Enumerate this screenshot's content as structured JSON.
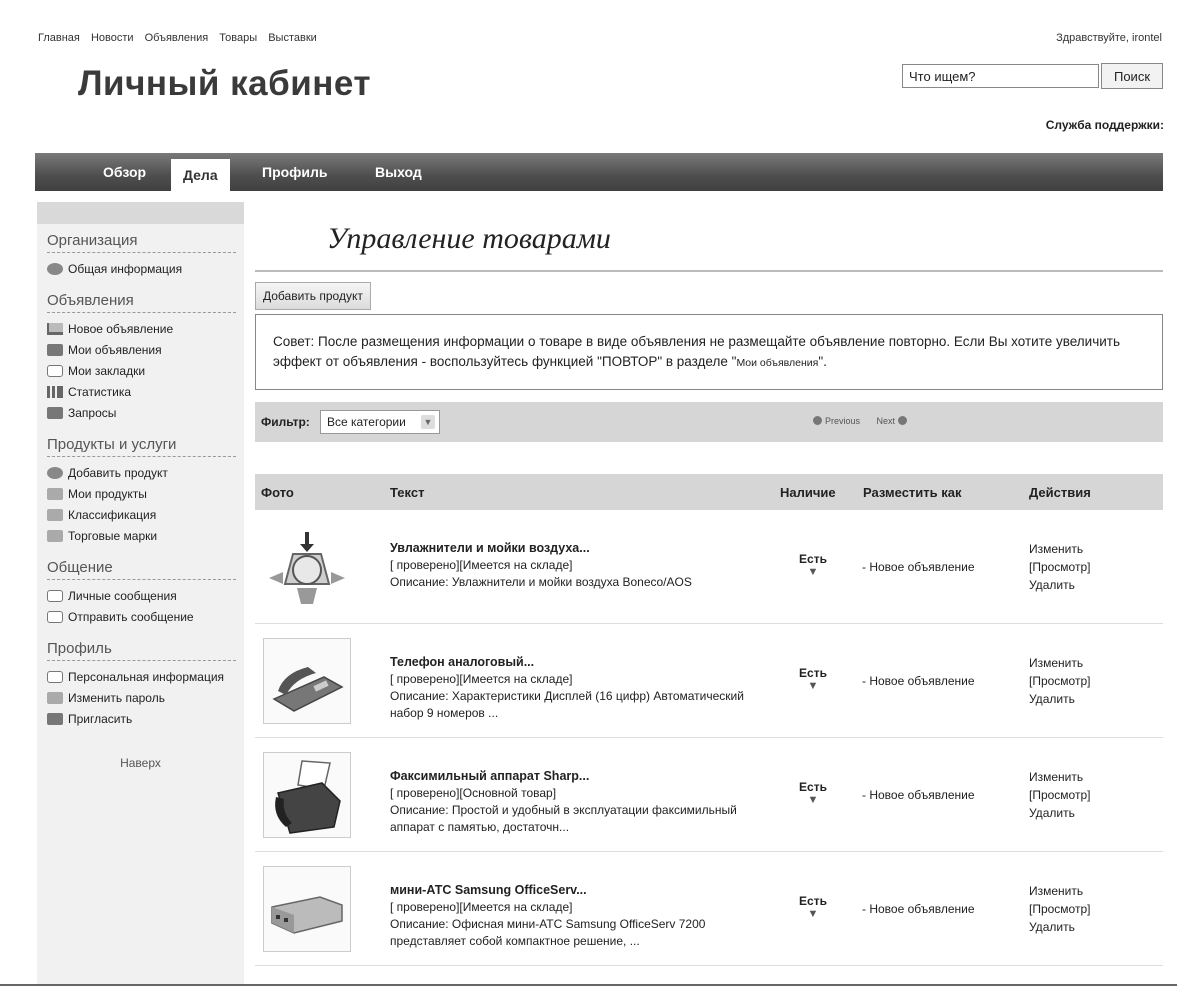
{
  "topnav": [
    "Главная",
    "Новости",
    "Объявления",
    "Товары",
    "Выставки"
  ],
  "greeting": "Здравствуйте, irontel",
  "site_title": "Личный кабинет",
  "search": {
    "value": "Что ищем?",
    "button": "Поиск"
  },
  "support": "Служба поддержки:",
  "menu": {
    "overview": "Обзор",
    "tasks": "Дела",
    "profile": "Профиль",
    "logout": "Выход"
  },
  "sidebar": {
    "sections": [
      {
        "title": "Организация",
        "items": [
          {
            "label": "Общая информация",
            "icon": "magnifier-icon"
          }
        ]
      },
      {
        "title": "Объявления",
        "items": [
          {
            "label": "Новое объявление",
            "icon": "cart-icon"
          },
          {
            "label": "Мои объявления",
            "icon": "board-icon"
          },
          {
            "label": "Мои закладки",
            "icon": "bookmark-icon"
          },
          {
            "label": "Статистика",
            "icon": "bar-chart-icon"
          },
          {
            "label": "Запросы",
            "icon": "inbox-icon"
          }
        ]
      },
      {
        "title": "Продукты и услуги",
        "items": [
          {
            "label": "Добавить продукт",
            "icon": "add-product-icon"
          },
          {
            "label": "Мои продукты",
            "icon": "box-icon"
          },
          {
            "label": "Классификация",
            "icon": "tree-icon"
          },
          {
            "label": "Торговые марки",
            "icon": "tag-icon"
          }
        ]
      },
      {
        "title": "Общение",
        "items": [
          {
            "label": "Личные сообщения",
            "icon": "chat-icon"
          },
          {
            "label": "Отправить сообщение",
            "icon": "send-icon"
          }
        ]
      },
      {
        "title": "Профиль",
        "items": [
          {
            "label": "Персональная информация",
            "icon": "person-card-icon"
          },
          {
            "label": "Изменить пароль",
            "icon": "key-icon"
          },
          {
            "label": "Пригласить",
            "icon": "monitor-icon"
          }
        ]
      }
    ],
    "top_link": "Наверх"
  },
  "page_title": "Управление товарами",
  "add_product": "Добавить продукт",
  "tip": {
    "text": "Совет: После размещения информации о товаре в виде объявления не размещайте объявление повторно. Если Вы хотите увеличить эффект от объявления - воспользуйтесь функцией \"ПОВТОР\" в разделе \"",
    "link": "Мои объявления",
    "tail": "\"."
  },
  "filter": {
    "label": "Фильтр:",
    "selected": "Все категории",
    "previous": "Previous",
    "next": "Next"
  },
  "table": {
    "headers": {
      "photo": "Фото",
      "text": "Текст",
      "stock": "Наличие",
      "place": "Разместить как",
      "actions": "Действия"
    },
    "rows": [
      {
        "name": "Увлажнители и мойки воздуха...",
        "status": "[ проверено][Имеется на складе]",
        "desc": "Описание: Увлажнители и мойки воздуха Boneco/AOS",
        "stock": "Есть",
        "place": "- Новое объявление",
        "photo": "humidifier"
      },
      {
        "name": "Телефон аналоговый...",
        "status": "[ проверено][Имеется на складе]",
        "desc": "Описание: Характеристики Дисплей (16 цифр) Автоматический набор 9 номеров ...",
        "stock": "Есть",
        "place": "- Новое объявление",
        "photo": "phone"
      },
      {
        "name": "Факсимильный аппарат Sharp...",
        "status": "[ проверено][Основной товар]",
        "desc": "Описание: Простой и удобный в эксплуатации факсимильный аппарат с памятью, достаточн...",
        "stock": "Есть",
        "place": "- Новое объявление",
        "photo": "fax"
      },
      {
        "name": "мини-АТС Samsung OfficeServ...",
        "status": "[ проверено][Имеется на складе]",
        "desc": "Описание: Офисная мини-АТС Samsung OfficeServ 7200 представляет собой компактное решение, ...",
        "stock": "Есть",
        "place": "- Новое объявление",
        "photo": "pbx"
      }
    ],
    "actions": {
      "edit": "Изменить",
      "view": "[Просмотр]",
      "delete": "Удалить"
    }
  }
}
